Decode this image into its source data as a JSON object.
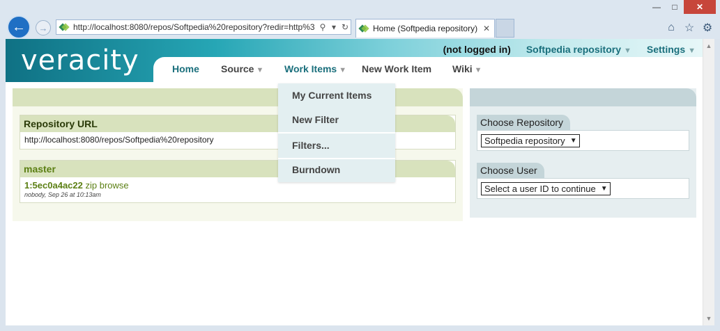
{
  "window": {
    "minimize": "—",
    "maximize": "□",
    "close": "✕"
  },
  "browser": {
    "address": "http://localhost:8080/repos/Softpedia%20repository?redir=http%3",
    "tab_title": "Home (Softpedia repository)",
    "tab_close": "✕"
  },
  "header": {
    "logo": "veracity",
    "not_logged_in": "(not logged in)",
    "repo_menu": "Softpedia repository",
    "settings_menu": "Settings"
  },
  "nav": {
    "home": "Home",
    "source": "Source",
    "work_items": "Work Items",
    "new_work_item": "New Work Item",
    "wiki": "Wiki"
  },
  "dropdown": {
    "items": [
      "My Current Items",
      "New Filter",
      "Filters...",
      "Burndown"
    ]
  },
  "repository": {
    "title": "Repository URL",
    "url": "http://localhost:8080/repos/Softpedia%20repository"
  },
  "branch": {
    "name": "master",
    "changeset": "1:5ec0a4ac22",
    "zip": "zip",
    "browse": "browse",
    "meta": "nobody, Sep 26 at 10:13am"
  },
  "sidebar": {
    "choose_repo_label": "Choose Repository",
    "repo_selected": "Softpedia repository",
    "choose_user_label": "Choose User",
    "user_selected": "Select a user ID to continue"
  }
}
